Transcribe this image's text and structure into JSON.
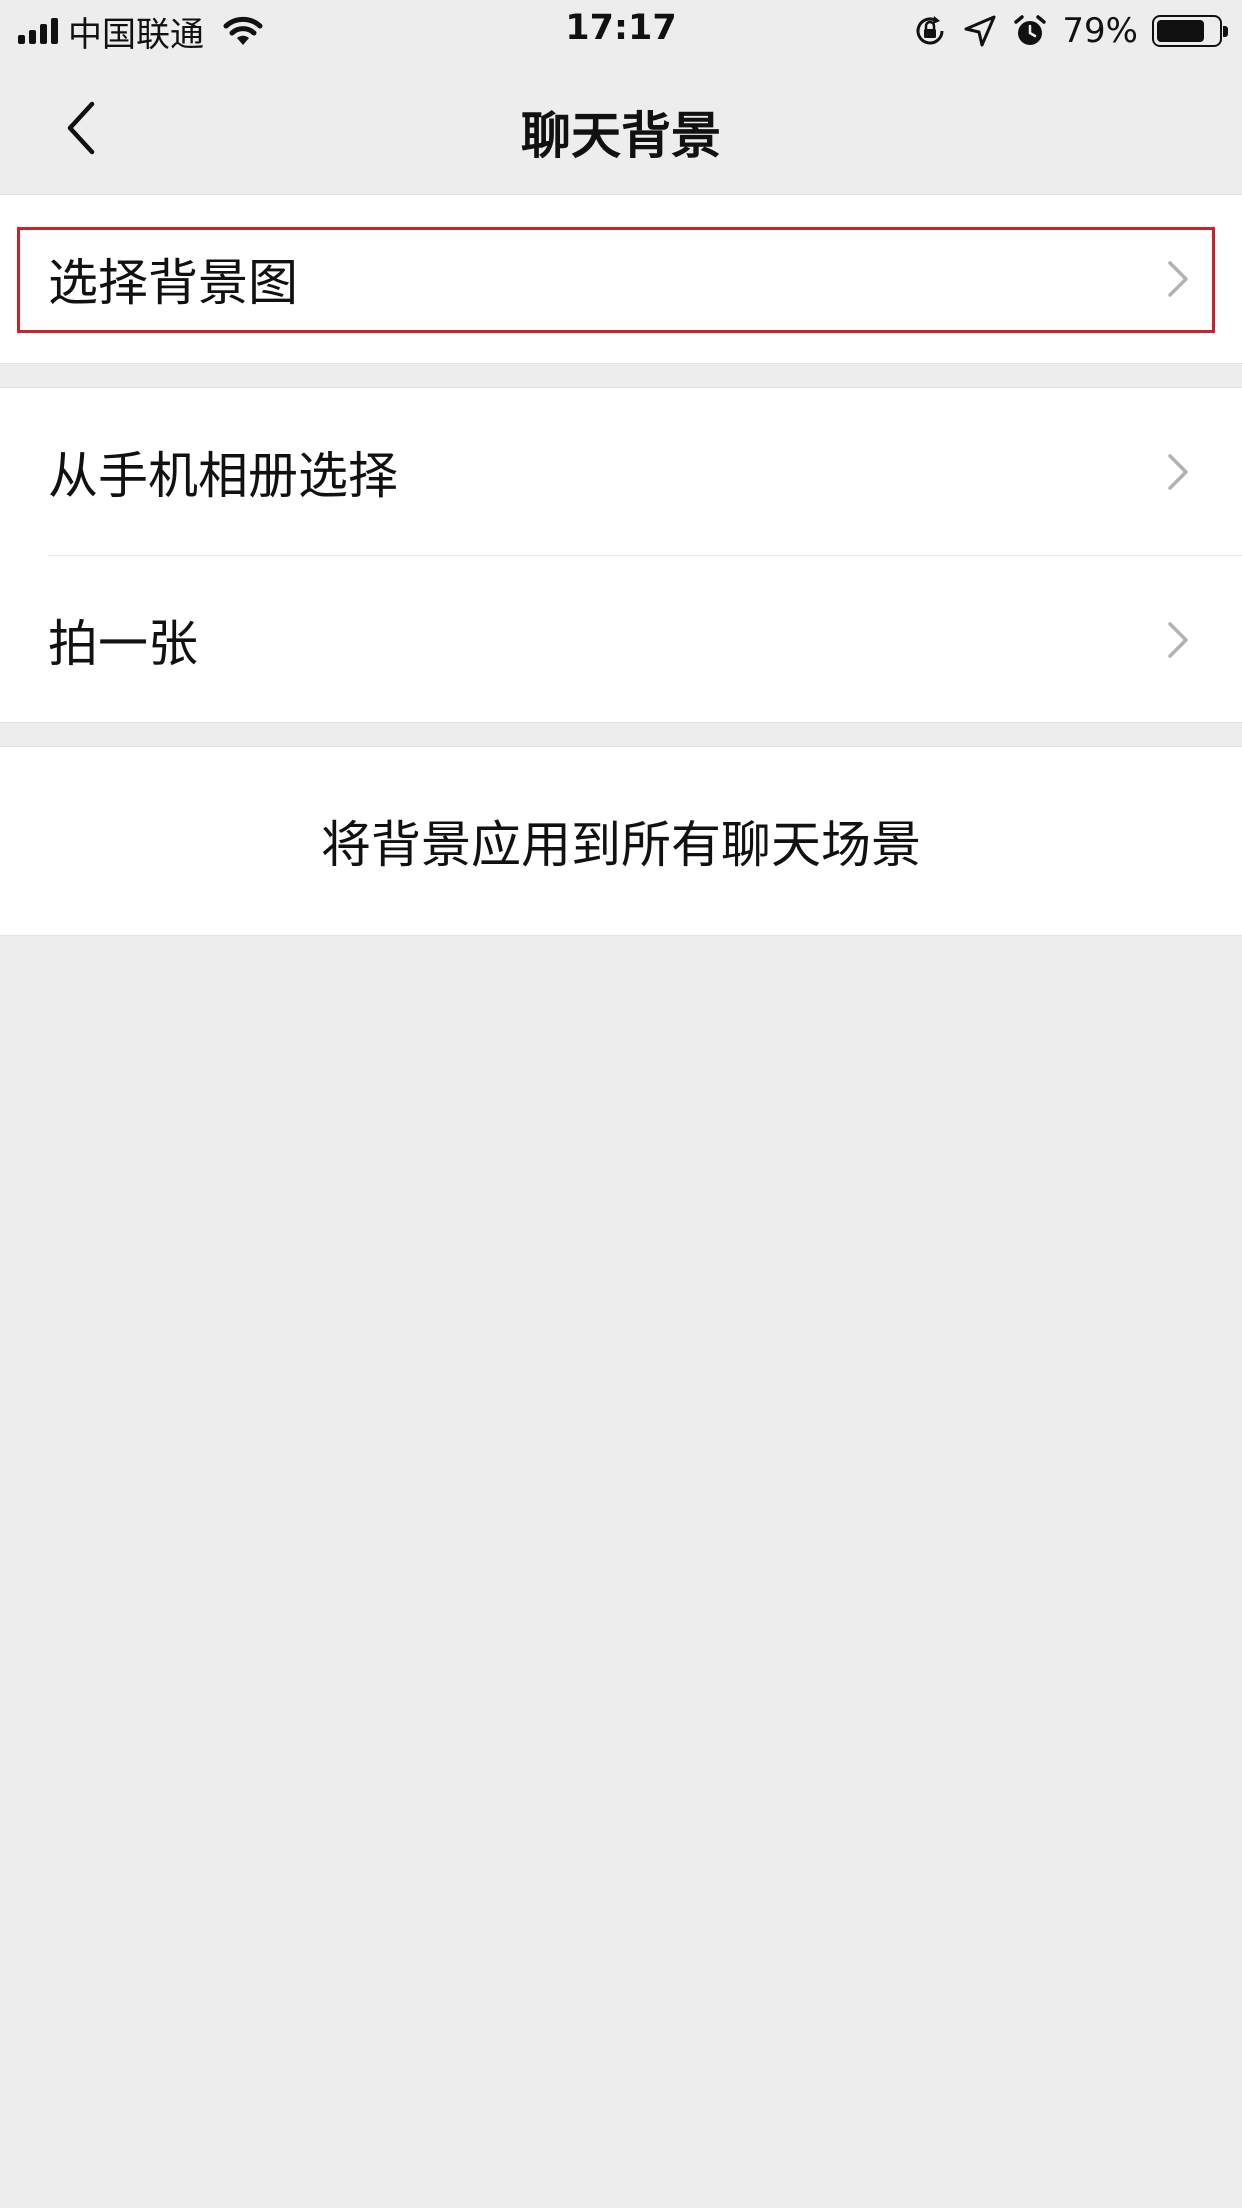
{
  "status_bar": {
    "carrier": "中国联通",
    "time": "17:17",
    "battery_percent": "79%",
    "battery_level": 0.79,
    "icons": [
      "signal-icon",
      "wifi-icon",
      "rotation-lock-icon",
      "location-icon",
      "alarm-icon",
      "battery-icon"
    ]
  },
  "nav": {
    "title": "聊天背景",
    "back_icon": "chevron-left-icon"
  },
  "groups": {
    "select_background": {
      "label": "选择背景图",
      "highlight_color": "#c8252b"
    },
    "photo_options": {
      "items": [
        {
          "label": "从手机相册选择"
        },
        {
          "label": "拍一张"
        }
      ]
    },
    "apply": {
      "label": "将背景应用到所有聊天场景"
    }
  },
  "colors": {
    "page_background": "#ededed",
    "cell_background": "#ffffff",
    "text": "#111111",
    "chevron": "#b2b2b2"
  }
}
